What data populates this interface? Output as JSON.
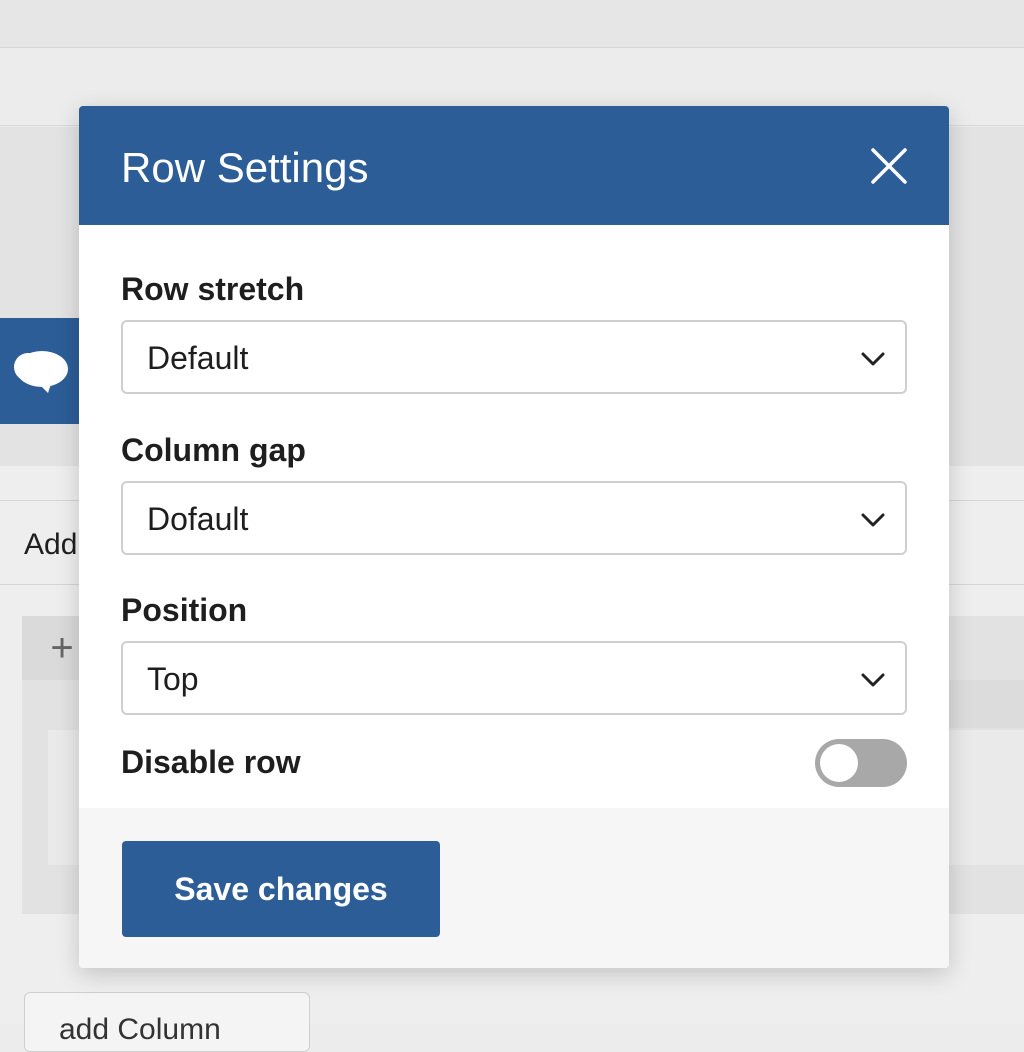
{
  "background": {
    "add_label": "Add",
    "add_column_label": "add Column"
  },
  "modal": {
    "title": "Row Settings",
    "fields": [
      {
        "label": "Row stretch",
        "value": "Default"
      },
      {
        "label": "Column gap",
        "value": "Dofault"
      },
      {
        "label": "Position",
        "value": "Top"
      }
    ],
    "toggle": {
      "label": "Disable row",
      "on": false
    },
    "save_label": "Save changes"
  },
  "colors": {
    "accent": "#2c5d97",
    "toggle_off": "#a8a8a8"
  },
  "icons": {
    "close": "close-icon",
    "chevron": "chevron-down-icon",
    "plus": "plus-icon",
    "logo": "cloud-logo-icon"
  }
}
